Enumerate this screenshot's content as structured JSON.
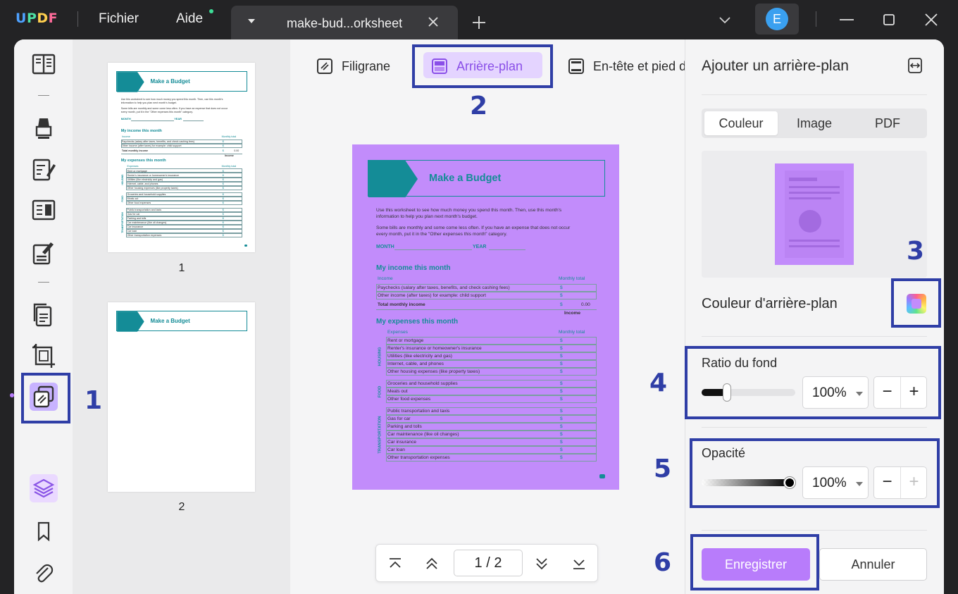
{
  "app": {
    "logo": "UPDF",
    "logo_colors": [
      "#4ea1ff",
      "#4ee0a3",
      "#ffcf4e",
      "#ff6b9a"
    ],
    "menu": {
      "file": "Fichier",
      "help": "Aide"
    },
    "tab_title": "make-bud...orksheet",
    "avatar_initial": "E"
  },
  "ribbon": {
    "watermark": "Filigrane",
    "background": "Arrière-plan",
    "header_footer": "En-tête et pied d"
  },
  "thumbnails": [
    {
      "page": "1"
    },
    {
      "page": "2"
    }
  ],
  "pager": {
    "current": "1",
    "separator": "/",
    "total": "2"
  },
  "panel": {
    "title": "Ajouter un arrière-plan",
    "tabs": {
      "color": "Couleur",
      "image": "Image",
      "pdf": "PDF"
    },
    "bg_color_label": "Couleur d'arrière-plan",
    "selected_color": "#c28cfb",
    "ratio_label": "Ratio du fond",
    "ratio_value": "100%",
    "ratio_fraction": 0.27,
    "opacity_label": "Opacité",
    "opacity_value": "100%",
    "opacity_fraction": 1.0,
    "minus": "−",
    "plus": "+",
    "save": "Enregistrer",
    "cancel": "Annuler"
  },
  "annotations": [
    "1",
    "2",
    "3",
    "4",
    "5",
    "6"
  ],
  "document": {
    "title": "Make a Budget",
    "intro1": "Use this worksheet to see how much money you spend this month. Then, use this month's",
    "intro1b": "information to help you plan next month's budget.",
    "intro2": "Some bills are monthly and some come less often. If you have an expense that does not occur",
    "intro2b": "every month, put it in the \"Other expenses this month\" category.",
    "month": "MONTH",
    "year": "YEAR",
    "income_heading": "My income this month",
    "income_col": "Income",
    "monthly_total": "Monthly total",
    "income_rows": [
      "Paychecks (salary after taxes, benefits, and check cashing fees)",
      "Other income (after taxes) for example: child support"
    ],
    "total_income": "Total monthly income",
    "total_value": "0.00",
    "income_caption": "Income",
    "dollar": "$",
    "expenses_heading": "My expenses this month",
    "expenses_col": "Expenses",
    "groups": [
      {
        "label": "HOUSING",
        "rows": [
          "Rent or mortgage",
          "Renter's insurance or homeowner's insurance",
          "Utilities (like electricity and gas)",
          "Internet, cable, and phones",
          "Other housing expenses (like property taxes)"
        ]
      },
      {
        "label": "FOOD",
        "rows": [
          "Groceries and household supplies",
          "Meals out",
          "Other food expenses"
        ]
      },
      {
        "label": "TRANSPORTATION",
        "rows": [
          "Public transportation and taxis",
          "Gas for car",
          "Parking and tolls",
          "Car maintenance (like oil changes)",
          "Car insurance",
          "Car loan",
          "Other transportation expenses"
        ]
      }
    ]
  }
}
